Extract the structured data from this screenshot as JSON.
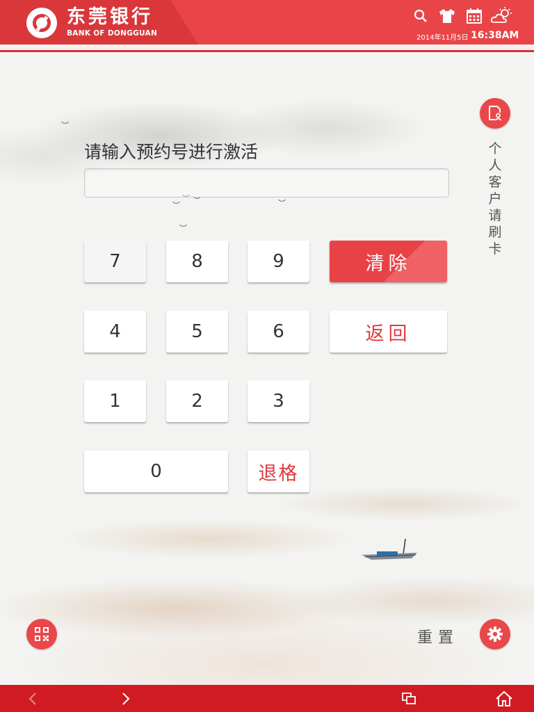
{
  "header": {
    "bank_name_cn": "东莞银行",
    "bank_name_en": "BANK OF DONGGUAN",
    "date": "2014年11月5日",
    "time": "16:38AM",
    "icons": [
      "search-icon",
      "shirt-icon",
      "calendar-icon",
      "weather-icon"
    ]
  },
  "side": {
    "card_prompt": "个人客户请刷卡",
    "card_icon": "id-card-icon"
  },
  "form": {
    "prompt": "请输入预约号进行激活",
    "input_value": ""
  },
  "keypad": {
    "digits": {
      "d7": "7",
      "d8": "8",
      "d9": "9",
      "d4": "4",
      "d5": "5",
      "d6": "6",
      "d1": "1",
      "d2": "2",
      "d3": "3",
      "d0": "0"
    },
    "clear_label": "清除",
    "back_label": "返回",
    "backspace_label": "退格"
  },
  "bottom": {
    "reset_label": "重置",
    "qr_icon": "qr-code-icon",
    "settings_icon": "gear-icon"
  },
  "footer": {
    "icons": [
      "back-arrow-icon",
      "forward-arrow-icon",
      "windows-icon",
      "home-icon"
    ]
  },
  "colors": {
    "brand_red": "#e94548",
    "footer_red": "#d11b23",
    "text_red": "#e2393c"
  }
}
